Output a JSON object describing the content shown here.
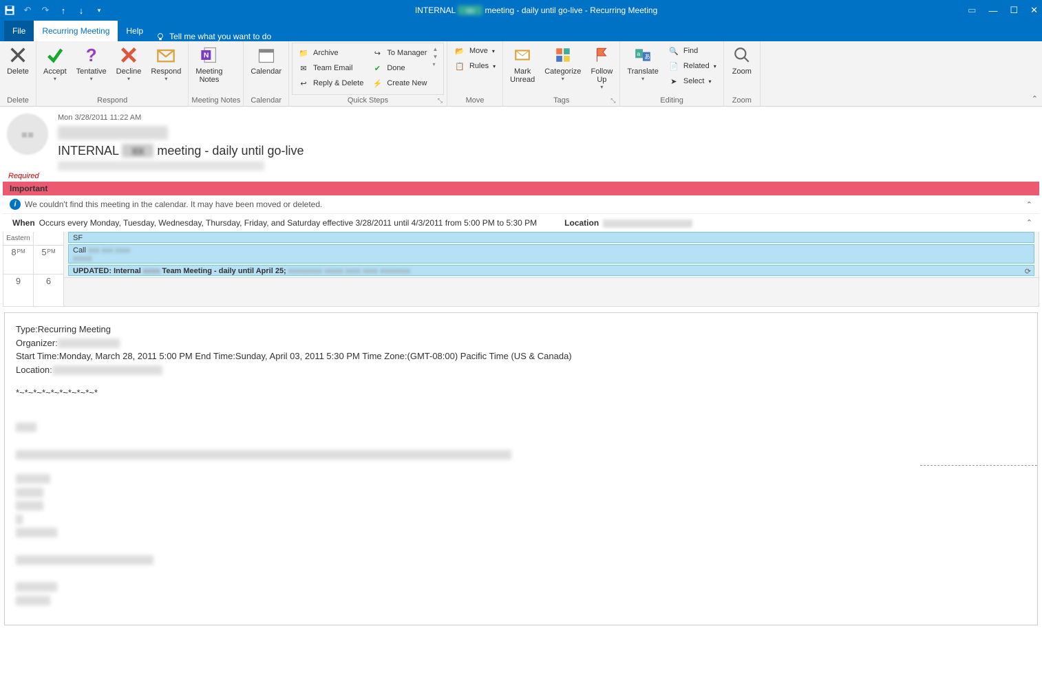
{
  "titlebar": {
    "title_prefix": "INTERNAL",
    "title_suffix": "meeting - daily until go-live  -  Recurring Meeting"
  },
  "tabs": {
    "file": "File",
    "recurring": "Recurring Meeting",
    "help": "Help",
    "tell_me": "Tell me what you want to do"
  },
  "ribbon": {
    "delete_group": {
      "delete": "Delete",
      "label": "Delete"
    },
    "respond_group": {
      "accept": "Accept",
      "tentative": "Tentative",
      "decline": "Decline",
      "respond": "Respond",
      "label": "Respond"
    },
    "notes_group": {
      "notes": "Meeting\nNotes",
      "label": "Meeting Notes"
    },
    "calendar_group": {
      "calendar": "Calendar",
      "label": "Calendar"
    },
    "quicksteps": {
      "archive": "Archive",
      "team_email": "Team Email",
      "reply_delete": "Reply & Delete",
      "to_manager": "To Manager",
      "done": "Done",
      "create_new": "Create New",
      "label": "Quick Steps"
    },
    "move_group": {
      "move": "Move",
      "rules": "Rules",
      "label": "Move"
    },
    "tags_group": {
      "mark_unread": "Mark\nUnread",
      "categorize": "Categorize",
      "follow_up": "Follow\nUp",
      "label": "Tags"
    },
    "editing_group": {
      "translate": "Translate",
      "find": "Find",
      "related": "Related",
      "select": "Select",
      "label": "Editing"
    },
    "zoom_group": {
      "zoom": "Zoom",
      "label": "Zoom"
    }
  },
  "header": {
    "date": "Mon 3/28/2011 11:22 AM",
    "subject_prefix": "INTERNAL",
    "subject_suffix": "meeting - daily until go-live",
    "required": "Required"
  },
  "banners": {
    "important": "Important",
    "notfound": "We couldn't find this meeting in the calendar. It may have been moved or deleted."
  },
  "whenloc": {
    "when_label": "When",
    "when_text": "Occurs every Monday, Tuesday, Wednesday, Thursday, Friday, and Saturday effective 3/28/2011 until 4/3/2011 from 5:00 PM to 5:30 PM",
    "location_label": "Location"
  },
  "calendar": {
    "tz_header": "Eastern",
    "left_hours": [
      "8",
      "9"
    ],
    "left_ampm": "PM",
    "right_hours": [
      "5",
      "6"
    ],
    "right_ampm": "PM",
    "appt_sf": "SF",
    "appt_call_prefix": "Call",
    "appt_updated": "UPDATED: Internal",
    "appt_updated_suffix": "Team Meeting - daily until April 25;"
  },
  "body": {
    "type_label": "Type:",
    "type_value": "Recurring Meeting",
    "organizer_label": "Organizer:",
    "start_label": "Start Time:",
    "start_value": "Monday, March 28, 2011 5:00 PM",
    "end_label": "End Time:",
    "end_value": "Sunday, April 03, 2011 5:30 PM",
    "tz_label": "Time Zone:",
    "tz_value": "(GMT-08:00) Pacific Time (US & Canada)",
    "location_label": "Location:",
    "separator": "*~*~*~*~*~*~*~*~*~*"
  }
}
